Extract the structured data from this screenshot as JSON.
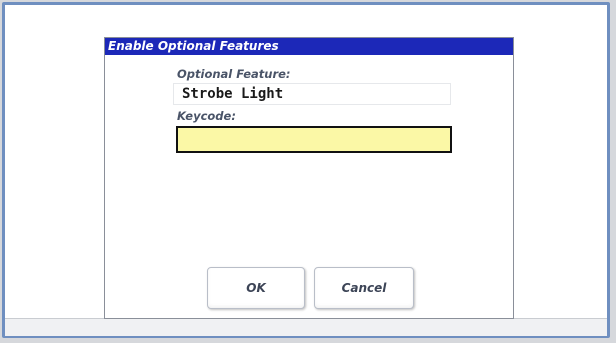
{
  "dialog": {
    "title": "Enable Optional Features",
    "feature_label": "Optional Feature:",
    "feature_value": "Strobe Light",
    "keycode_label": "Keycode:",
    "keycode_value": "",
    "ok_label": "OK",
    "cancel_label": "Cancel"
  },
  "colors": {
    "titlebar": "#1c28b8",
    "keycode_field_background": "#fbf8a6",
    "frame_border": "#6f8fc0"
  }
}
